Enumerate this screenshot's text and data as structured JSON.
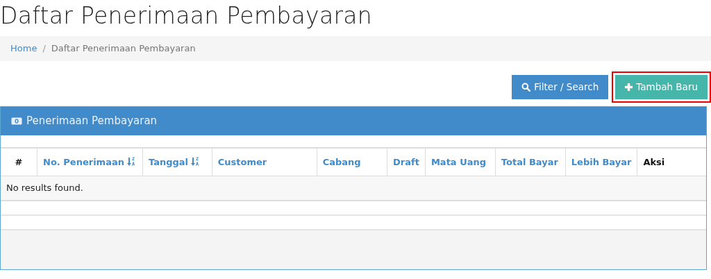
{
  "page_title": "Daftar Penerimaan Pembayaran",
  "breadcrumb": [
    {
      "label": "Home",
      "kind": "link"
    },
    {
      "separator": "/",
      "label": "Daftar Penerimaan Pembayaran",
      "kind": "current"
    }
  ],
  "buttons": [
    {
      "label": "Filter / Search",
      "kind": "filter",
      "highlighted": false
    },
    {
      "label": "Tambah Baru",
      "kind": "add",
      "highlighted": true
    }
  ],
  "panel": {
    "title": "Penerimaan Pembayaran",
    "table": {
      "columns": [
        {
          "label": "#",
          "kind": "plain"
        },
        {
          "label": "No. Penerimaan",
          "kind": "sorted"
        },
        {
          "label": "Tanggal",
          "kind": "sorted"
        },
        {
          "label": "Customer",
          "kind": "link"
        },
        {
          "label": "Cabang",
          "kind": "link"
        },
        {
          "label": "Draft",
          "kind": "link"
        },
        {
          "label": "Mata Uang",
          "kind": "link"
        },
        {
          "label": "Total Bayar",
          "kind": "link"
        },
        {
          "label": "Lebih Bayar",
          "kind": "link"
        },
        {
          "label": "Aksi",
          "kind": "plain"
        }
      ],
      "empty_message": "No results found."
    }
  }
}
